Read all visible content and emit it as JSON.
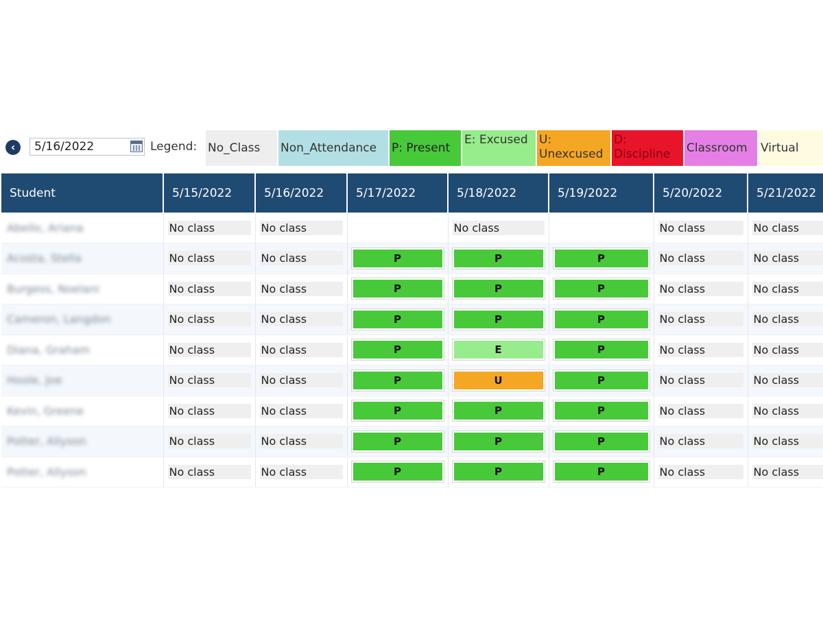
{
  "toolbar": {
    "date_value": "5/16/2022",
    "legend_label": "Legend:",
    "back_icon": "arrow-left-circle-icon",
    "calendar_icon": "calendar-icon"
  },
  "legend": [
    {
      "key": "no_class",
      "label": "No_Class",
      "color": "#eeeeee",
      "text_color": "#333333"
    },
    {
      "key": "non_attendance",
      "label": "Non_Attendance",
      "color": "#b2dfe3",
      "text_color": "#333333"
    },
    {
      "key": "present",
      "label": "P: Present",
      "color": "#47c93a",
      "text_color": "#222222"
    },
    {
      "key": "excused",
      "label": "E: Excused",
      "color": "#97ec8b",
      "text_color": "#333333"
    },
    {
      "key": "unexcused",
      "label": "U: Unexcused",
      "color": "#f5a623",
      "text_color": "#333333"
    },
    {
      "key": "discipline",
      "label": "D: Discipline",
      "color": "#e8142a",
      "text_color": "#8a0010"
    },
    {
      "key": "classroom",
      "label": "Classroom",
      "color": "#e57fe6",
      "text_color": "#333333"
    },
    {
      "key": "virtual",
      "label": "Virtual",
      "color": "#fffbe0",
      "text_color": "#333333"
    }
  ],
  "table": {
    "headers": [
      "Student",
      "5/15/2022",
      "5/16/2022",
      "5/17/2022",
      "5/18/2022",
      "5/19/2022",
      "5/20/2022",
      "5/21/2022"
    ],
    "no_class_text": "No class",
    "mark_colors": {
      "P": "#47c93a",
      "E": "#97ec8b",
      "U": "#f5a623"
    },
    "rows": [
      {
        "student": "Abello, Ariana",
        "cells": [
          "No class",
          "No class",
          "",
          "No class",
          "",
          "No class",
          "No class"
        ]
      },
      {
        "student": "Acosta, Stella",
        "cells": [
          "No class",
          "No class",
          "P",
          "P",
          "P",
          "No class",
          "No class"
        ]
      },
      {
        "student": "Burgess, Noelani",
        "cells": [
          "No class",
          "No class",
          "P",
          "P",
          "P",
          "No class",
          "No class"
        ]
      },
      {
        "student": "Cameron, Langdon",
        "cells": [
          "No class",
          "No class",
          "P",
          "P",
          "P",
          "No class",
          "No class"
        ]
      },
      {
        "student": "Diana, Graham",
        "cells": [
          "No class",
          "No class",
          "P",
          "E",
          "P",
          "No class",
          "No class"
        ]
      },
      {
        "student": "Hoole, Joe",
        "cells": [
          "No class",
          "No class",
          "P",
          "U",
          "P",
          "No class",
          "No class"
        ]
      },
      {
        "student": "Kevin, Greene",
        "cells": [
          "No class",
          "No class",
          "P",
          "P",
          "P",
          "No class",
          "No class"
        ]
      },
      {
        "student": "Potter, Allyson",
        "cells": [
          "No class",
          "No class",
          "P",
          "P",
          "P",
          "No class",
          "No class"
        ]
      },
      {
        "student": "Potter, Allyson",
        "cells": [
          "No class",
          "No class",
          "P",
          "P",
          "P",
          "No class",
          "No class"
        ]
      }
    ]
  }
}
